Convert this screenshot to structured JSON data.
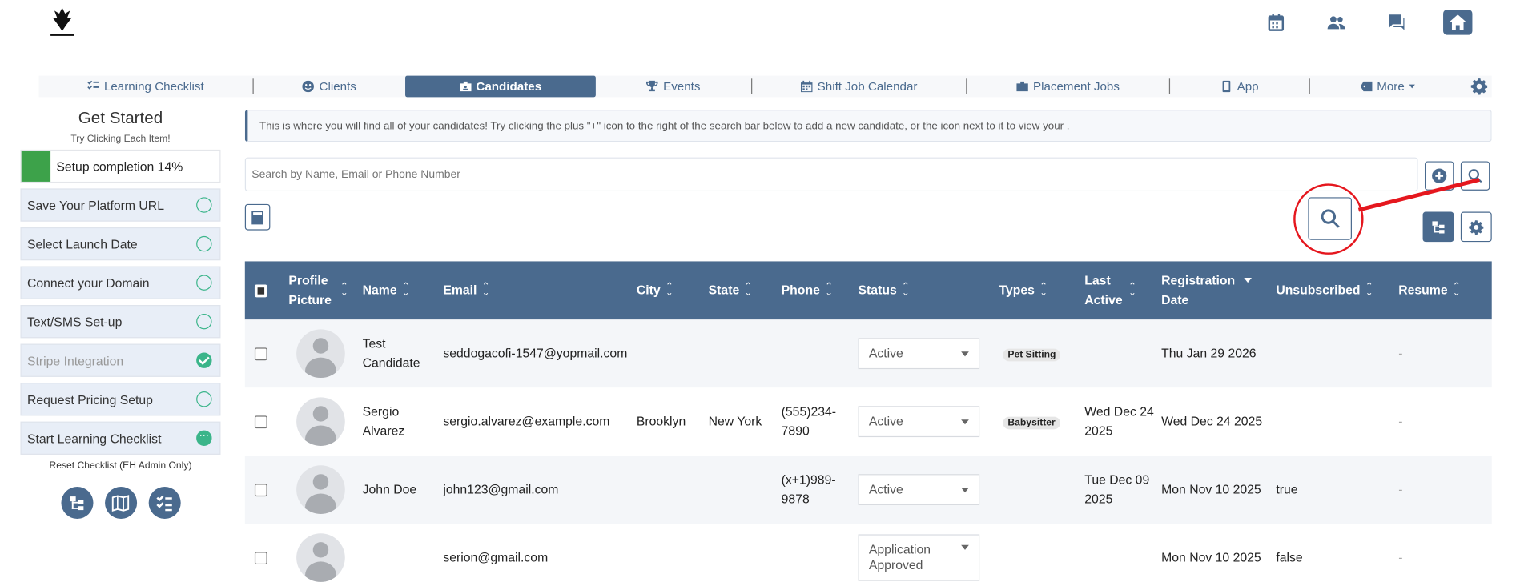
{
  "top_icons": [
    "calendar-icon",
    "users-icon",
    "chat-icon",
    "home-icon"
  ],
  "nav": [
    {
      "label": "Learning Checklist",
      "icon": "checklist-icon"
    },
    {
      "label": "Clients",
      "icon": "smile-icon"
    },
    {
      "label": "Candidates",
      "icon": "briefcase-id-icon",
      "active": true
    },
    {
      "label": "Events",
      "icon": "trophy-icon"
    },
    {
      "label": "Shift Job Calendar",
      "icon": "calendar-icon"
    },
    {
      "label": "Placement Jobs",
      "icon": "briefcase-icon"
    },
    {
      "label": "App",
      "icon": "phone-icon"
    },
    {
      "label": "More",
      "icon": "tag-icon"
    }
  ],
  "sidebar": {
    "title": "Get Started",
    "subtitle": "Try Clicking Each Item!",
    "progress_label": "Setup completion 14%",
    "progress_percent": 14,
    "steps": [
      {
        "label": "Save Your Platform URL",
        "state": "open"
      },
      {
        "label": "Select Launch Date",
        "state": "open"
      },
      {
        "label": "Connect your Domain",
        "state": "open"
      },
      {
        "label": "Text/SMS Set-up",
        "state": "open"
      },
      {
        "label": "Stripe Integration",
        "state": "done"
      },
      {
        "label": "Request Pricing Setup",
        "state": "open"
      },
      {
        "label": "Start Learning Checklist",
        "state": "in-progress"
      }
    ],
    "reset_label": "Reset Checklist (EH Admin Only)"
  },
  "info_text": "This is where you will find all of your candidates! Try clicking the plus \"+\" icon to the right of the search bar below to add a new candidate, or the icon next to it to view your .",
  "search": {
    "placeholder": "Search by Name, Email or Phone Number"
  },
  "table": {
    "headers": {
      "profile": "Profile Picture",
      "name": "Name",
      "email": "Email",
      "city": "City",
      "state": "State",
      "phone": "Phone",
      "status": "Status",
      "types": "Types",
      "last_active": "Last Active",
      "registration": "Registration Date",
      "unsubscribed": "Unsubscribed",
      "resume": "Resume"
    },
    "rows": [
      {
        "name": "Test Candidate",
        "email": "seddogacofi-1547@yopmail.com",
        "city": "",
        "state": "",
        "phone": "",
        "status": "Active",
        "type": "Pet Sitting",
        "last_active": "",
        "registration": "Thu Jan 29 2026",
        "unsubscribed": "",
        "resume": "-"
      },
      {
        "name": "Sergio Alvarez",
        "email": "sergio.alvarez@example.com",
        "city": "Brooklyn",
        "state": "New York",
        "phone": "(555)234-7890",
        "status": "Active",
        "type": "Babysitter",
        "last_active": "Wed Dec 24 2025",
        "registration": "Wed Dec 24 2025",
        "unsubscribed": "",
        "resume": "-"
      },
      {
        "name": "John Doe",
        "email": "john123@gmail.com",
        "city": "",
        "state": "",
        "phone": "(x+1)989-9878",
        "status": "Active",
        "type": "",
        "last_active": "Tue Dec 09 2025",
        "registration": "Mon Nov 10 2025",
        "unsubscribed": "true",
        "resume": "-"
      },
      {
        "name": "",
        "email": "serion@gmail.com",
        "city": "",
        "state": "",
        "phone": "",
        "status": "Application Approved",
        "type": "",
        "last_active": "",
        "registration": "Mon Nov 10 2025",
        "unsubscribed": "false",
        "resume": "-"
      }
    ]
  }
}
